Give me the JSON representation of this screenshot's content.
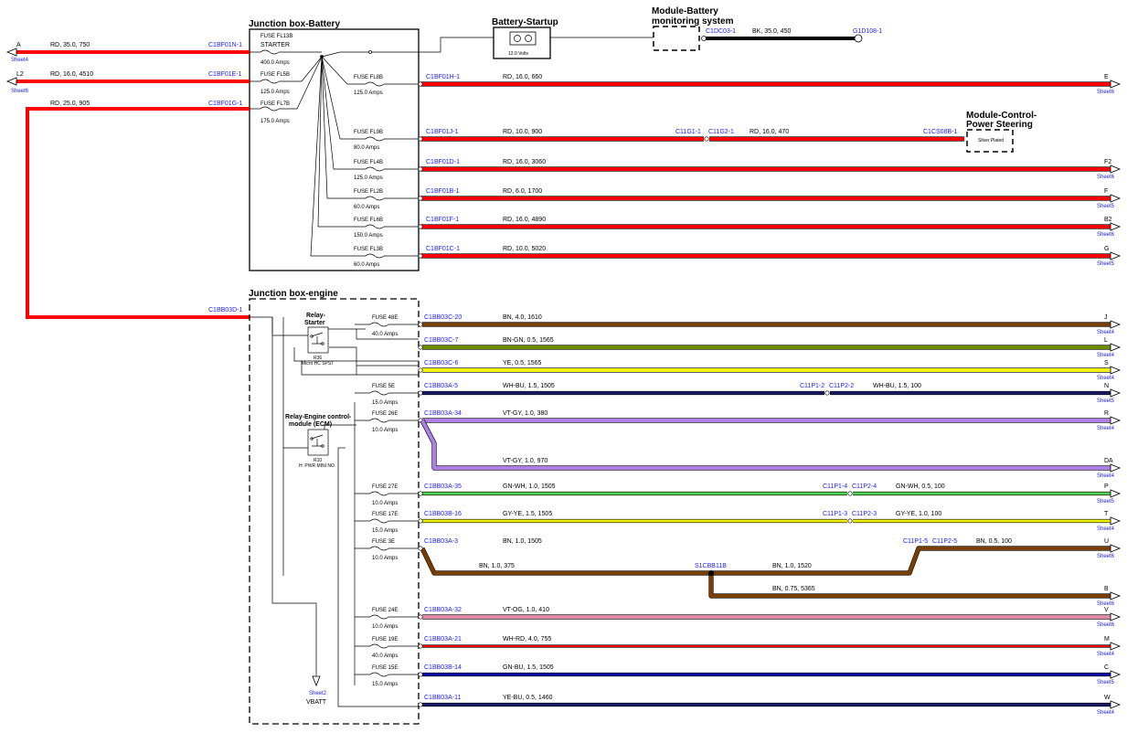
{
  "boxes": {
    "jb_battery": "Junction box-Battery",
    "jb_engine": "Junction box-engine",
    "battery": "Battery-Startup",
    "battery_volts": "12.0 Volts",
    "bms_l1": "Module-Battery",
    "bms_l2": "monitoring system",
    "mcps_l1": "Module-Control-",
    "mcps_l2": "Power Steering",
    "silver": "Silver Plated",
    "relay_starter_l1": "Relay-",
    "relay_starter_l2": "Starter",
    "relay_starter_id": "R36",
    "relay_starter_type": "Micro HC SPST",
    "relay_ecm_l1": "Relay-Engine control-",
    "relay_ecm_l2": "module (ECM)",
    "relay_ecm_id": "R10",
    "relay_ecm_type": "H: PWR MINI NO",
    "vbatt_sheet": "Sheet2",
    "vbatt": "VBATT"
  },
  "left_wires": [
    {
      "dest": "A",
      "sheet": "Sheet4",
      "spec": "RD,  35.0,  750",
      "conn": "C1BF01N-1"
    },
    {
      "dest": "L2",
      "sheet": "Sheet6",
      "spec": "RD,  16.0,  4510",
      "conn": "C1BF01E-1"
    },
    {
      "dest": "",
      "sheet": "",
      "spec": "RD,  25.0,  905",
      "conn": "C1BF01G-1"
    }
  ],
  "jbb_left_fuses": [
    {
      "name": "FUSE FL13B",
      "extra": "STARTER",
      "amps": "400.0 Amps"
    },
    {
      "name": "FUSE FL5B",
      "extra": "",
      "amps": "125.0 Amps"
    },
    {
      "name": "FUSE FL7B",
      "extra": "",
      "amps": "175.0 Amps"
    }
  ],
  "bms_wire": {
    "conn": "C1DC03-1",
    "spec": "BK,  35.0,  450",
    "ground": "G1D108-1"
  },
  "jbb_outputs": [
    {
      "fuse": "FUSE FL8B",
      "amps": "125.0 Amps",
      "conn": "C1BF01H-1",
      "spec": "RD,  16.0,  660",
      "dest": "E",
      "sheet": "Sheet6"
    },
    {
      "fuse": "FUSE FL9B",
      "amps": "80.0 Amps",
      "conn": "C1BF01J-1",
      "spec": "RD,  10.0,  900",
      "dest": "",
      "sheet": ""
    },
    {
      "fuse": "FUSE FL4B",
      "amps": "125.0 Amps",
      "conn": "C1BF01D-1",
      "spec": "RD,  16.0,  3060",
      "dest": "F2",
      "sheet": "Sheet6"
    },
    {
      "fuse": "FUSE FL2B",
      "amps": "60.0 Amps",
      "conn": "C1BF01B-1",
      "spec": "RD,  6.0,  1700",
      "dest": "F",
      "sheet": "Sheet5"
    },
    {
      "fuse": "FUSE FL6B",
      "amps": "150.0 Amps",
      "conn": "C1BF01F-1",
      "spec": "RD,  16.0,  4890",
      "dest": "B2",
      "sheet": "Sheet6"
    },
    {
      "fuse": "FUSE FL3B",
      "amps": "60.0 Amps",
      "conn": "C1BF01C-1",
      "spec": "RD,  10.0,  5020",
      "dest": "G",
      "sheet": "Sheet5"
    }
  ],
  "ps_wire": {
    "c1": "C11G1-1",
    "c2": "C11G2-1",
    "spec": "RD,  16.0,  470",
    "conn": "C1CS08B-1"
  },
  "eng_in_conn": "C1BB03D-1",
  "eng_outputs": [
    {
      "fuse": "FUSE 48E",
      "amps": "40.0 Amps",
      "conn": "C1BB03C-20",
      "spec": "BN,  4.0,  1610",
      "dest": "J",
      "sheet": "Sheet4"
    },
    {
      "fuse": "",
      "amps": "",
      "conn": "C1BB03C-7",
      "spec": "BN-GN,  0.5,  1565",
      "dest": "L",
      "sheet": "Sheet4"
    },
    {
      "fuse": "",
      "amps": "",
      "conn": "C1BB03C-6",
      "spec": "YE,  0.5,  1565",
      "dest": "S",
      "sheet": "Sheet4"
    },
    {
      "fuse": "FUSE 5E",
      "amps": "15.0 Amps",
      "conn": "C1BB03A-5",
      "spec": "WH-BU,  1.5,  1505",
      "dest": "N",
      "sheet": "Sheet5",
      "c1": "C11P1-2",
      "c2": "C11P2-2",
      "spec2": "WH-BU,  1.5,  100"
    },
    {
      "fuse": "FUSE 26E",
      "amps": "10.0 Amps",
      "conn": "C1BB03A-34",
      "spec": "VT-GY,  1.0,  380",
      "dest": "R",
      "sheet": "Sheet4"
    },
    {
      "fuse": "",
      "amps": "",
      "conn": "",
      "spec": "VT-GY,  1.0,  970",
      "dest": "DA",
      "sheet": "Sheet4"
    },
    {
      "fuse": "FUSE 27E",
      "amps": "10.0 Amps",
      "conn": "C1BB03A-35",
      "spec": "GN-WH,  1.0,  1505",
      "dest": "P",
      "sheet": "Sheet5",
      "c1": "C11P1-4",
      "c2": "C11P2-4",
      "spec2": "GN-WH,  0.5,  100"
    },
    {
      "fuse": "FUSE 17E",
      "amps": "15.0 Amps",
      "conn": "C1BB03B-16",
      "spec": "GY-YE,  1.5,  1505",
      "dest": "T",
      "sheet": "Sheet4",
      "c1": "C11P1-3",
      "c2": "C11P2-3",
      "spec2": "GY-YE,  1.0,  100"
    },
    {
      "fuse": "FUSE 3E",
      "amps": "10.0 Amps",
      "conn": "C1BB03A-3",
      "spec": "BN,  1.0,  1505",
      "dest": "U",
      "sheet": "Sheet6",
      "c1": "C11P1-5",
      "c2": "C11P2-5",
      "spec2": "BN,  0.5,  100"
    },
    {
      "fuse": "",
      "amps": "",
      "conn": "",
      "spec": "BN,  0.75,  5365",
      "dest": "B",
      "sheet": "Sheet6"
    },
    {
      "fuse": "FUSE 24E",
      "amps": "10.0 Amps",
      "conn": "C1BB03A-32",
      "spec": "VT-OG,  1.0,  410",
      "dest": "V",
      "sheet": "Sheet6"
    },
    {
      "fuse": "FUSE 19E",
      "amps": "40.0 Amps",
      "conn": "C1BB03A-21",
      "spec": "WH-RD,  4.0,  755",
      "dest": "M",
      "sheet": "Sheet4"
    },
    {
      "fuse": "FUSE 15E",
      "amps": "15.0 Amps",
      "conn": "C1BB03B-14",
      "spec": "GN-BU,  1.5,  1505",
      "dest": "C",
      "sheet": "Sheet5"
    },
    {
      "fuse": "",
      "amps": "",
      "conn": "C1BB03A-11",
      "spec": "YE-BU,  0.5,  1460",
      "dest": "W",
      "sheet": "Sheet4"
    }
  ],
  "splice": {
    "name": "S1CBB11B",
    "spec_left": "BN,  1.0,  375",
    "spec_mid": "BN,  1.0,  1520"
  },
  "colors": {
    "red": "#ff0000",
    "brown": "#7a3f00",
    "violet": "#b07ee8",
    "yellow": "#f2f20a",
    "green": "#52d152",
    "blue": "#0000aa",
    "pink": "#e08aa8",
    "navy": "#1a1a66"
  }
}
